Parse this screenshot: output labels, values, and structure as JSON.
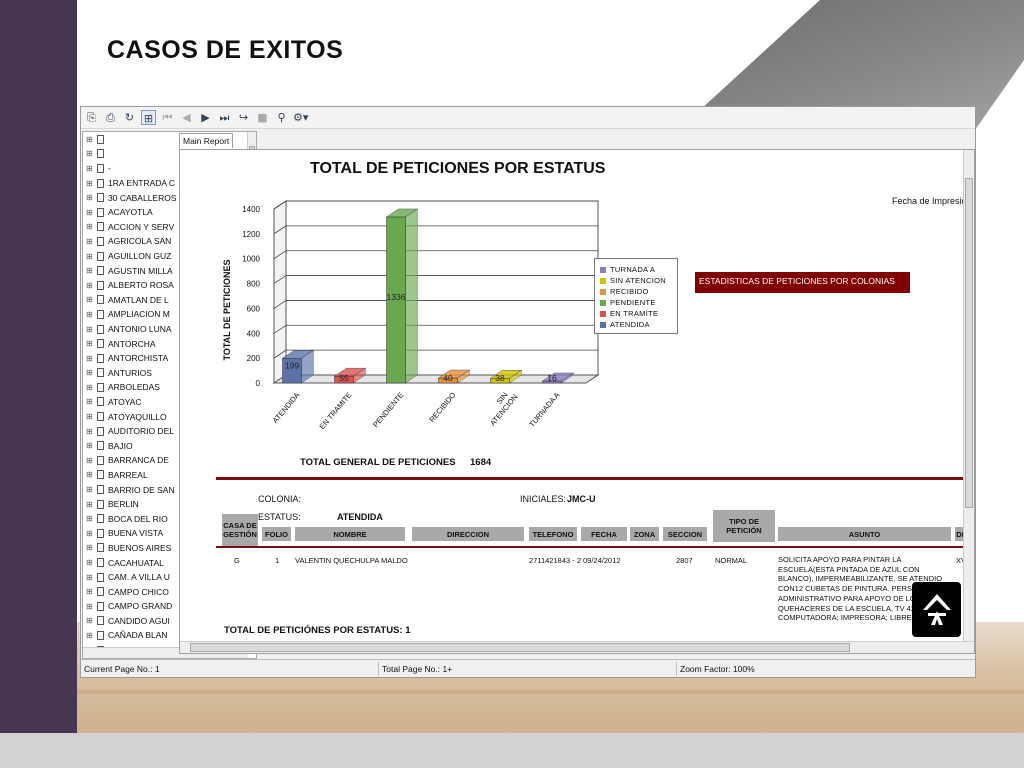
{
  "slide": {
    "title": "CASOS DE EXITOS"
  },
  "toolbar": {
    "icons": [
      "export-icon",
      "print-icon",
      "refresh-icon",
      "group-tree-icon",
      "first-page-icon",
      "prev-page-icon",
      "next-page-icon",
      "last-page-icon",
      "goto-page-icon",
      "stop-icon",
      "search-icon",
      "zoom-icon"
    ]
  },
  "tree": {
    "items": [
      "",
      "",
      "-",
      "1RA ENTRADA C",
      "30 CABALLEROS",
      "ACAYOTLA",
      "ACCION Y SERV",
      "AGRICOLA SAN",
      "AGUILLON GUZ",
      "AGUSTIN MILLA",
      "ALBERTO ROSA",
      "AMATLAN DE L",
      "AMPLIACION M",
      "ANTONIO LUNA",
      "ANTORCHA",
      "ANTORCHISTA",
      "ANTURIOS",
      "ARBOLEDAS",
      "ATOYAC",
      "ATOYAQUILLO",
      "AUDITORIO DEL",
      "BAJIO",
      "BARRANCA DE",
      "BARREAL",
      "BARRIO DE SAN",
      "BERLIN",
      "BOCA DEL RIO",
      "BUENA VISTA",
      "BUENOS AIRES",
      "CACAHUATAL",
      "CAM. A VILLA U",
      "CAMPO CHICO",
      "CAMPO GRAND",
      "CANDIDO AGUI",
      "CAÑADA BLAN",
      "CAOTICA"
    ]
  },
  "tabs": [
    "Main Report"
  ],
  "report": {
    "fecha_label": "Fecha de Impresió",
    "est_box": "ESTADISTICAS DE PETICIONES POR COLONIAS",
    "total_general_label": "TOTAL GENERAL DE PETICIONES",
    "total_general_value": "1684",
    "colonia_label": "COLONIA:",
    "iniciales_label": "INICIALES:",
    "iniciales_value": "JMC-U",
    "estatus_label": "ESTATUS:",
    "estatus_value": "ATENDIDA",
    "columns": [
      "CASA DE GESTIÓN",
      "FOLIO",
      "NOMBRE",
      "DIRECCION",
      "TELEFONO",
      "FECHA",
      "ZONA",
      "SECCION",
      "TIPO DE PETICIÓN",
      "ASUNTO",
      "DI"
    ],
    "row": {
      "casa": "G",
      "folio": "1",
      "nombre": "VALENTIN QUECHULPA MALDONA",
      "telefono": "2711421843 - 27",
      "fecha": "09/24/2012",
      "seccion": "2807",
      "tipo": "NORMAL",
      "asunto": "SOLICITA APOYO PARA PINTAR LA ESCUELA(ESTA PINTADA DE AZUL CON BLANCO), IMPERMEABILIZANTE. SE ATENDIO CON12 CUBETAS DE PINTURA. PERSONAL ADMINISTRATIVO PARA APOYO DE LOS QUEHACERES DE LA ESCUELA, TV 42\" A COMPUTADORA; IMPRESORA; LIBRERO",
      "di": "XV"
    },
    "total_status_label": "TOTAL DE PETICIÓNES POR ESTATUS:",
    "total_status_value": "1"
  },
  "status": {
    "current_page": "Current Page No.: 1",
    "total_page": "Total Page No.: 1+",
    "zoom": "Zoom Factor: 100%"
  },
  "colors": {
    "atendida": "#5a74a8",
    "en_tramite": "#d9534f",
    "pendiente": "#6aa84f",
    "recibido": "#e69138",
    "sin_atencion": "#d4c400",
    "turnada_a": "#8e7cc3",
    "header_red": "#800000"
  },
  "chart_data": {
    "type": "bar",
    "title": "TOTAL  DE PETICIONES POR ESTATUS",
    "ylabel": "TOTAL DE PETICIONES",
    "xlabel": "",
    "categories": [
      "ATENDIDA",
      "EN TRAMITE",
      "PENDIENTE",
      "RECIBIDO",
      "SIN ATENCION",
      "TURNADA A"
    ],
    "values": [
      199,
      55,
      1336,
      40,
      38,
      16
    ],
    "ylim": [
      0,
      1400
    ],
    "yticks": [
      0,
      200,
      400,
      600,
      800,
      1000,
      1200,
      1400
    ],
    "grid": true,
    "legend_position": "right",
    "legend": [
      "TURNADA A",
      "SIN ATENCION",
      "RECIBIDO",
      "PENDIENTE",
      "EN TRAMITE",
      "ATENDIDA"
    ]
  }
}
